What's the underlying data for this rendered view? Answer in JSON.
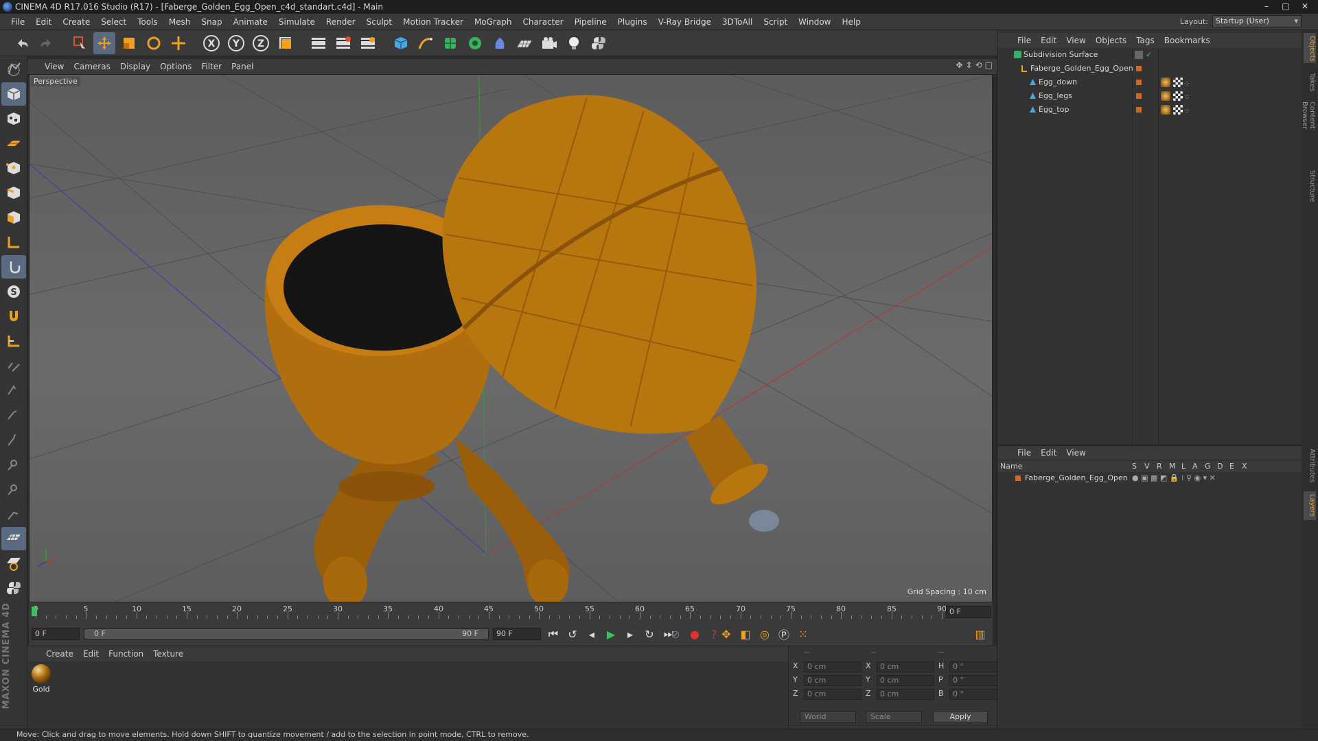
{
  "window": {
    "title": "CINEMA 4D R17.016 Studio (R17) - [Faberge_Golden_Egg_Open_c4d_standart.c4d] - Main",
    "controls": [
      "–",
      "□",
      "✕"
    ]
  },
  "menubar": [
    "File",
    "Edit",
    "Create",
    "Select",
    "Tools",
    "Mesh",
    "Snap",
    "Animate",
    "Simulate",
    "Render",
    "Sculpt",
    "Motion Tracker",
    "MoGraph",
    "Character",
    "Pipeline",
    "Plugins",
    "V-Ray Bridge",
    "3DToAll",
    "Script",
    "Window",
    "Help"
  ],
  "layout": {
    "label": "Layout:",
    "value": "Startup (User)"
  },
  "toolbar": {
    "axis_x": "X",
    "axis_y": "Y",
    "axis_z": "Z"
  },
  "viewport": {
    "menu": [
      "View",
      "Cameras",
      "Display",
      "Options",
      "Filter",
      "Panel"
    ],
    "label": "Perspective",
    "grid_spacing": "Grid Spacing : 10 cm"
  },
  "timeline": {
    "ticks": [
      "0",
      "5",
      "10",
      "15",
      "20",
      "25",
      "30",
      "35",
      "40",
      "45",
      "50",
      "55",
      "60",
      "65",
      "70",
      "75",
      "80",
      "85",
      "90"
    ],
    "current_frame": "0 F",
    "start_field": "0 F",
    "slider_left": "0 F",
    "slider_right": "90 F",
    "end_field": "90 F"
  },
  "material_manager": {
    "menu": [
      "Create",
      "Edit",
      "Function",
      "Texture"
    ],
    "materials": [
      {
        "name": "Gold"
      }
    ]
  },
  "coordinates": {
    "headers": [
      "--",
      "--",
      "--"
    ],
    "rows": [
      {
        "l1": "X",
        "v1": "0 cm",
        "l2": "X",
        "v2": "0 cm",
        "l3": "H",
        "v3": "0 °"
      },
      {
        "l1": "Y",
        "v1": "0 cm",
        "l2": "Y",
        "v2": "0 cm",
        "l3": "P",
        "v3": "0 °"
      },
      {
        "l1": "Z",
        "v1": "0 cm",
        "l2": "Z",
        "v2": "0 cm",
        "l3": "B",
        "v3": "0 °"
      }
    ],
    "mode": "World",
    "scale": "Scale",
    "apply": "Apply"
  },
  "object_manager": {
    "menu": [
      "File",
      "Edit",
      "View",
      "Objects",
      "Tags",
      "Bookmarks"
    ],
    "objects": [
      {
        "name": "Subdivision Surface"
      },
      {
        "name": "Faberge_Golden_Egg_Open"
      },
      {
        "name": "Egg_down"
      },
      {
        "name": "Egg_legs"
      },
      {
        "name": "Egg_top"
      }
    ]
  },
  "layer_manager": {
    "menu": [
      "File",
      "Edit",
      "View"
    ],
    "columns": [
      "Name",
      "S",
      "V",
      "R",
      "M",
      "L",
      "A",
      "G",
      "D",
      "E",
      "X"
    ],
    "layers": [
      {
        "name": "Faberge_Golden_Egg_Open"
      }
    ]
  },
  "side_tabs": [
    "Objects",
    "Takes",
    "Content Browser",
    "Structure",
    "Attributes",
    "Layers"
  ],
  "status": "Move: Click and drag to move elements. Hold down SHIFT to quantize movement / add to the selection in point mode, CTRL to remove.",
  "colors": {
    "accent": "#e8a030",
    "selected": "#5a6a80",
    "gold": "#c8820e"
  }
}
